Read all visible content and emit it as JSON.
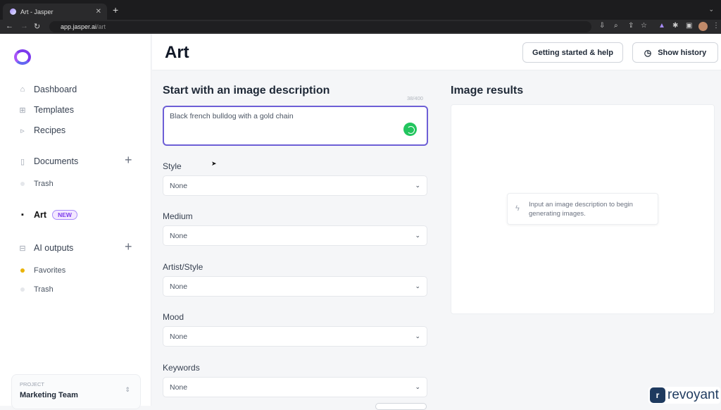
{
  "browser": {
    "tab_title": "Art - Jasper",
    "url_host": "app.jasper.ai",
    "url_path": "/art"
  },
  "sidebar": {
    "items": [
      {
        "label": "Dashboard",
        "icon": "home-icon"
      },
      {
        "label": "Templates",
        "icon": "grid-icon"
      },
      {
        "label": "Recipes",
        "icon": "play-box-icon"
      },
      {
        "label": "Documents",
        "icon": "document-icon"
      },
      {
        "label": "Trash",
        "icon": "dot-icon"
      },
      {
        "label": "Art",
        "icon": "image-icon",
        "badge": "NEW"
      },
      {
        "label": "AI outputs",
        "icon": "inbox-icon"
      },
      {
        "label": "Favorites",
        "icon": "dot-icon"
      },
      {
        "label": "Trash",
        "icon": "dot-icon"
      }
    ],
    "project": {
      "label": "PROJECT",
      "name": "Marketing Team"
    }
  },
  "header": {
    "title": "Art",
    "help_label": "Getting started & help",
    "history_label": "Show history"
  },
  "form": {
    "heading": "Start with an image description",
    "counter": "38/400",
    "description": "Black french bulldog with a gold chain",
    "fields": [
      {
        "label": "Style",
        "value": "None"
      },
      {
        "label": "Medium",
        "value": "None"
      },
      {
        "label": "Artist/Style",
        "value": "None"
      },
      {
        "label": "Mood",
        "value": "None"
      },
      {
        "label": "Keywords",
        "value": "None"
      }
    ]
  },
  "results": {
    "heading": "Image results",
    "hint": "Input an image description to begin generating images."
  },
  "watermark": {
    "text": "revoyant",
    "letter": "r"
  },
  "colors": {
    "accent": "#7c3aed",
    "input_border": "#6d5fd6",
    "spinner": "#22c55e"
  }
}
